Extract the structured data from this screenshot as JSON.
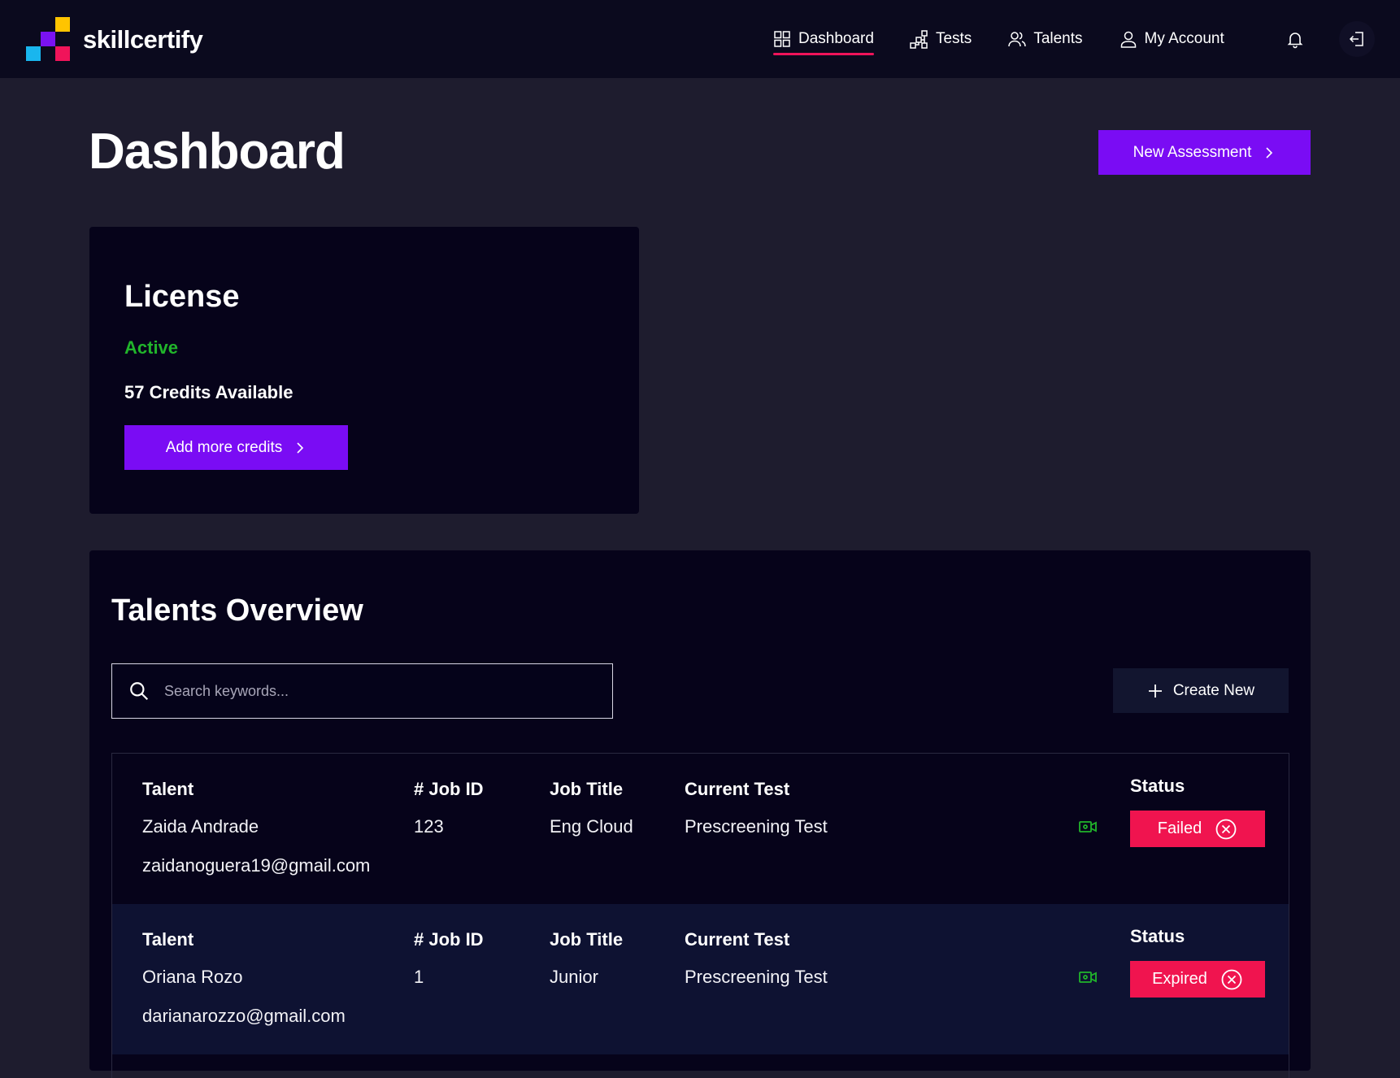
{
  "brand": {
    "name": "skillcertify"
  },
  "nav": {
    "items": [
      {
        "label": "Dashboard",
        "icon": "grid-icon",
        "active": true
      },
      {
        "label": "Tests",
        "icon": "hierarchy-icon",
        "active": false
      },
      {
        "label": "Talents",
        "icon": "users-icon",
        "active": false
      },
      {
        "label": "My Account",
        "icon": "user-icon",
        "active": false
      }
    ],
    "notifications_icon": "bell-icon",
    "logout_icon": "logout-icon"
  },
  "page": {
    "title": "Dashboard",
    "new_assessment_label": "New Assessment"
  },
  "license": {
    "title": "License",
    "status": "Active",
    "credits": "57 Credits Available",
    "add_credits_label": "Add more credits"
  },
  "talents": {
    "title": "Talents Overview",
    "search_placeholder": "Search keywords...",
    "search_value": "",
    "create_new_label": "Create New",
    "columns": {
      "talent": "Talent",
      "job_id": "# Job ID",
      "job_title": "Job Title",
      "current_test": "Current Test",
      "status": "Status"
    },
    "rows": [
      {
        "name": "Zaida Andrade",
        "email": "zaidanoguera19@gmail.com",
        "job_id": "123",
        "job_title": "Eng Cloud",
        "current_test": "Prescreening Test",
        "status": "Failed"
      },
      {
        "name": "Oriana Rozo",
        "email": "darianarozzo@gmail.com",
        "job_id": "1",
        "job_title": "Junior",
        "current_test": "Prescreening Test",
        "status": "Expired"
      }
    ]
  },
  "colors": {
    "accent": "#7a0cf4",
    "danger": "#f0144f",
    "success": "#21b52b",
    "nav_active": "#f0145a"
  }
}
